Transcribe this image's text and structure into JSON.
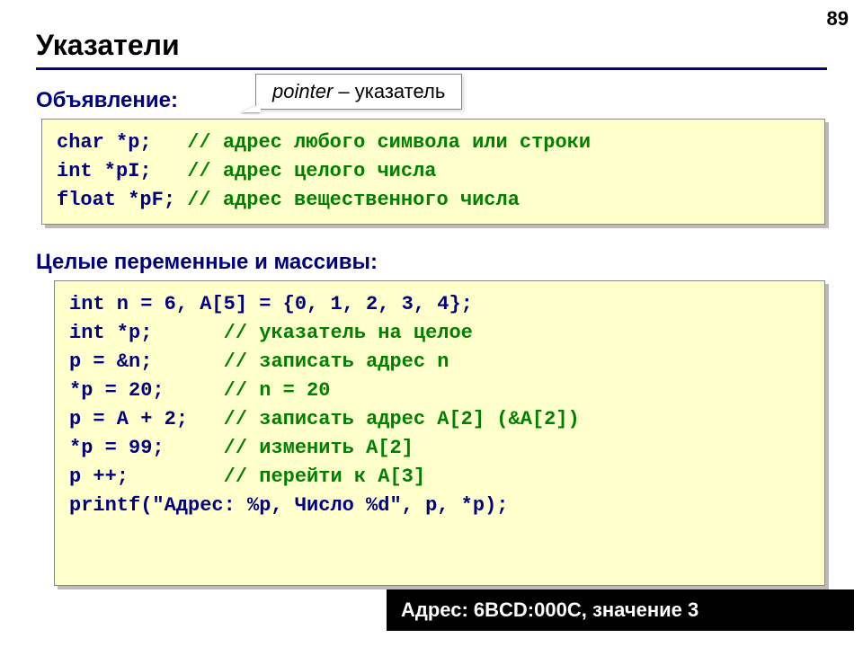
{
  "page_number": "89",
  "title": "Указатели",
  "callout": {
    "em": "pointer",
    "rest": " – указатель"
  },
  "section1_label": "Объявление:",
  "section2_label": "Целые переменные и массивы:",
  "code1": {
    "l1a": "char *p;   ",
    "l1b": "// адрес любого символа или строки",
    "l2a": "int *pI;   ",
    "l2b": "// адрес целого числа",
    "l3a": "float *pF; ",
    "l3b": "// адрес вещественного числа"
  },
  "code2": {
    "l1": "int n = 6, A[5] = {0, 1, 2, 3, 4};",
    "l2a": "int *p;      ",
    "l2b": "// указатель на целое",
    "l3a": "p = &n;      ",
    "l3b": "// записать адрес n",
    "l4a": "*p = 20;     ",
    "l4b": "// n = 20",
    "l5a": "p = A + 2;   ",
    "l5b": "// записать адрес A[2] (&A[2])",
    "l6a": "*p = 99;     ",
    "l6b": "// изменить A[2]",
    "l7a": "p ++;        ",
    "l7b": "// перейти к A[3]",
    "l8": "printf(\"Адрес: %p, Число %d\", p, *p);"
  },
  "output": "Адрес: 6BCD:000C, значение 3"
}
